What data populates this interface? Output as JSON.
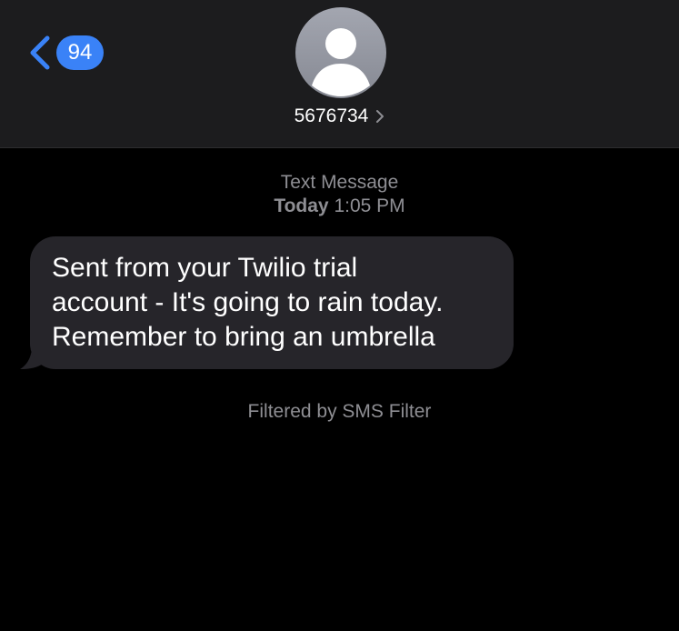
{
  "header": {
    "back_icon": "chevron-left-icon",
    "unread_count": "94",
    "contact_name": "5676734",
    "contact_chevron_icon": "chevron-right-icon",
    "avatar_icon": "person-silhouette-icon"
  },
  "thread": {
    "service_label": "Text Message",
    "day_label": "Today",
    "time_label": "1:05 PM",
    "messages": [
      {
        "direction": "incoming",
        "lines": [
          "Sent from your Twilio trial",
          "account - It's going to rain today.",
          "Remember to bring an umbrella"
        ]
      }
    ],
    "filter_note": "Filtered by SMS Filter"
  },
  "colors": {
    "background": "#000000",
    "header_bg": "#1c1c1e",
    "badge_blue": "#3a82f7",
    "bubble_gray": "#26252a",
    "secondary_text": "#8e8e93"
  }
}
